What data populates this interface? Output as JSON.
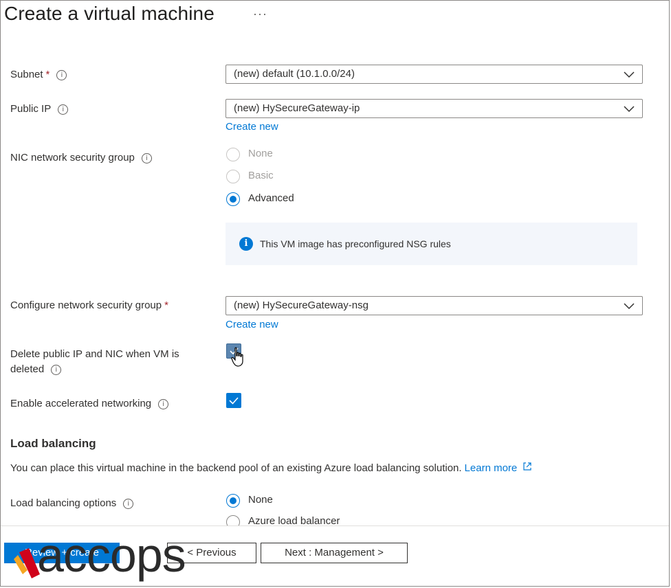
{
  "page": {
    "title": "Create a virtual machine",
    "more": "···"
  },
  "subnet": {
    "label": "Subnet",
    "required": "*",
    "info": "i",
    "value": "(new) default (10.1.0.0/24)"
  },
  "public_ip": {
    "label": "Public IP",
    "info": "i",
    "value": "(new) HySecureGateway-ip",
    "create_new": "Create new"
  },
  "nic_nsg": {
    "label": "NIC network security group",
    "info": "i",
    "options": [
      "None",
      "Basic",
      "Advanced"
    ],
    "selected": "Advanced",
    "info_message": "This VM image has preconfigured NSG rules",
    "info_icon": "i"
  },
  "configure_nsg": {
    "label": "Configure network security group",
    "required": "*",
    "value": "(new) HySecureGateway-nsg",
    "create_new": "Create new"
  },
  "delete_ip_nic": {
    "label_line1": "Delete public IP and NIC when VM is",
    "label_line2": "deleted",
    "info": "i",
    "checked": true
  },
  "accel_net": {
    "label": "Enable accelerated networking",
    "info": "i",
    "checked": true
  },
  "load_balancing": {
    "heading": "Load balancing",
    "description": "You can place this virtual machine in the backend pool of an existing Azure load balancing solution.",
    "learn_more": "Learn more",
    "options_label": "Load balancing options",
    "info": "i",
    "options": [
      "None",
      "Azure load balancer"
    ],
    "selected": "None"
  },
  "footer": {
    "review_create": "Review + create",
    "previous": "< Previous",
    "next": "Next : Management >"
  },
  "watermark": {
    "text": "accops"
  },
  "colors": {
    "accent": "#0078d4",
    "required": "#a4262c",
    "text": "#323130"
  }
}
